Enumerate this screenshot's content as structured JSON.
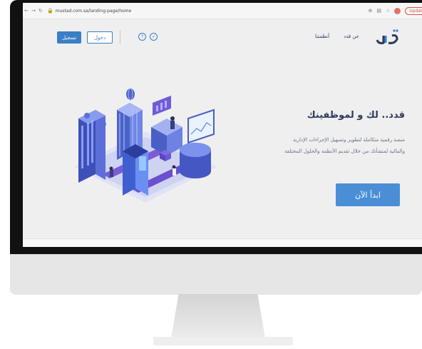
{
  "browser": {
    "back_icon": "arrow-left-icon",
    "forward_icon": "arrow-right-icon",
    "reload_icon": "reload-icon",
    "url": "mustad.com.sa/landing-page/home",
    "update_label": "Update"
  },
  "header": {
    "register_label": "تسجيل",
    "login_label": "دخول",
    "nav": {
      "about": "عن قدد",
      "systems": "أنظمتنا"
    },
    "circle_icons": [
      "?",
      "✓"
    ]
  },
  "hero": {
    "title": "قدد.. لك و لموظفينك",
    "description": "منصة رقمية متكاملة لتطوير وتسهيل الإجراءات الإدارية والمالية لمنشأتك من خلال تقديم الأنظمة والحلول المختلفة",
    "start_label": "ابدأ الآن"
  },
  "colors": {
    "accent": "#3a7fc4",
    "button": "#4a8fd6",
    "title": "#2d3a5a",
    "background": "#efefef"
  }
}
